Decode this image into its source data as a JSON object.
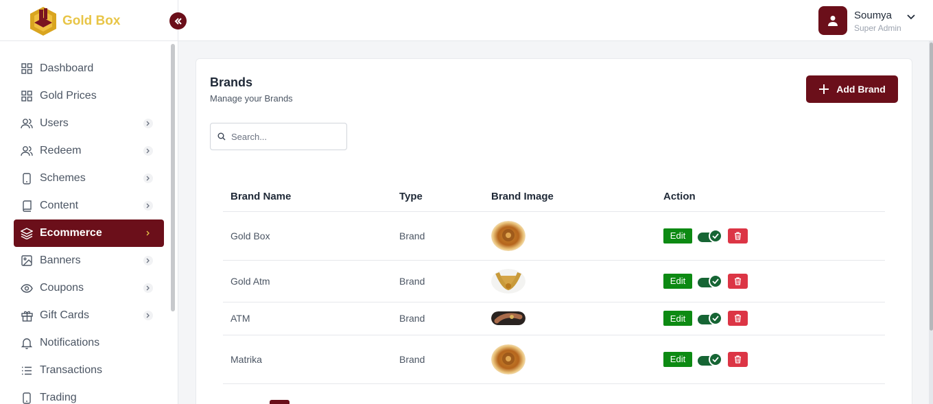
{
  "brand": {
    "name": "Gold Box",
    "accent": "#6b0f1a",
    "gold": "#e8c547"
  },
  "user": {
    "name": "Soumya",
    "role": "Super Admin"
  },
  "sidebar": {
    "items": [
      {
        "label": "Dashboard",
        "icon": "grid-icon",
        "has_children": false
      },
      {
        "label": "Gold Prices",
        "icon": "grid-icon",
        "has_children": false
      },
      {
        "label": "Users",
        "icon": "users-icon",
        "has_children": true
      },
      {
        "label": "Redeem",
        "icon": "users-icon",
        "has_children": true
      },
      {
        "label": "Schemes",
        "icon": "phone-icon",
        "has_children": true
      },
      {
        "label": "Content",
        "icon": "book-icon",
        "has_children": true
      },
      {
        "label": "Ecommerce",
        "icon": "layers-icon",
        "has_children": true,
        "active": true
      },
      {
        "label": "Banners",
        "icon": "image-icon",
        "has_children": true
      },
      {
        "label": "Coupons",
        "icon": "eye-icon",
        "has_children": true
      },
      {
        "label": "Gift Cards",
        "icon": "gift-icon",
        "has_children": true
      },
      {
        "label": "Notifications",
        "icon": "bell-icon",
        "has_children": false
      },
      {
        "label": "Transactions",
        "icon": "list-icon",
        "has_children": false
      },
      {
        "label": "Trading",
        "icon": "phone-icon",
        "has_children": false
      }
    ]
  },
  "page": {
    "title": "Brands",
    "subtitle": "Manage your Brands",
    "add_button": "Add Brand",
    "search_placeholder": "Search..."
  },
  "table": {
    "columns": [
      "Brand Name",
      "Type",
      "Brand Image",
      "Action"
    ],
    "rows": [
      {
        "name": "Gold Box",
        "type": "Brand",
        "image": "gold-jewelry-thumbnail",
        "active": true
      },
      {
        "name": "Gold Atm",
        "type": "Brand",
        "image": "gold-necklace-thumbnail",
        "active": true
      },
      {
        "name": "ATM",
        "type": "Brand",
        "image": "hand-ring-thumbnail",
        "active": true
      },
      {
        "name": "Matrika",
        "type": "Brand",
        "image": "gold-jewelry-thumbnail",
        "active": true
      }
    ],
    "edit_label": "Edit"
  }
}
